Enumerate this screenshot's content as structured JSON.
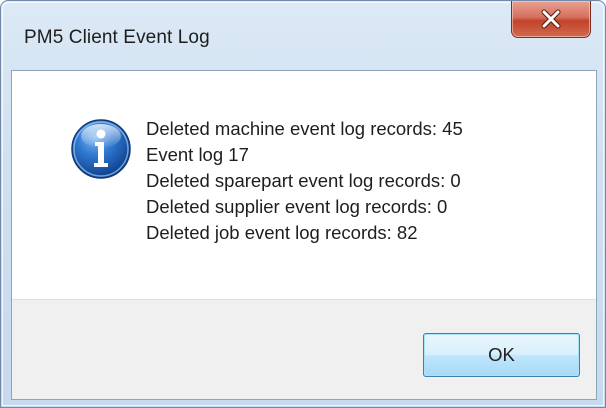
{
  "window": {
    "title": "PM5 Client Event Log",
    "close_icon": "close-icon"
  },
  "dialog": {
    "icon": "information-icon",
    "messages": [
      "Deleted machine event log records:  45",
      "Event log 17",
      "Deleted sparepart event log records:  0",
      "Deleted supplier event log records:  0",
      "Deleted job event log records:  82"
    ]
  },
  "buttons": {
    "ok_label": "OK"
  },
  "colors": {
    "titlebar": "#cfe0f1",
    "close_button": "#c3432b",
    "info_icon": "#1f63b5",
    "button_bar": "#f0f0f0",
    "ok_button_border": "#3c7fb1"
  }
}
